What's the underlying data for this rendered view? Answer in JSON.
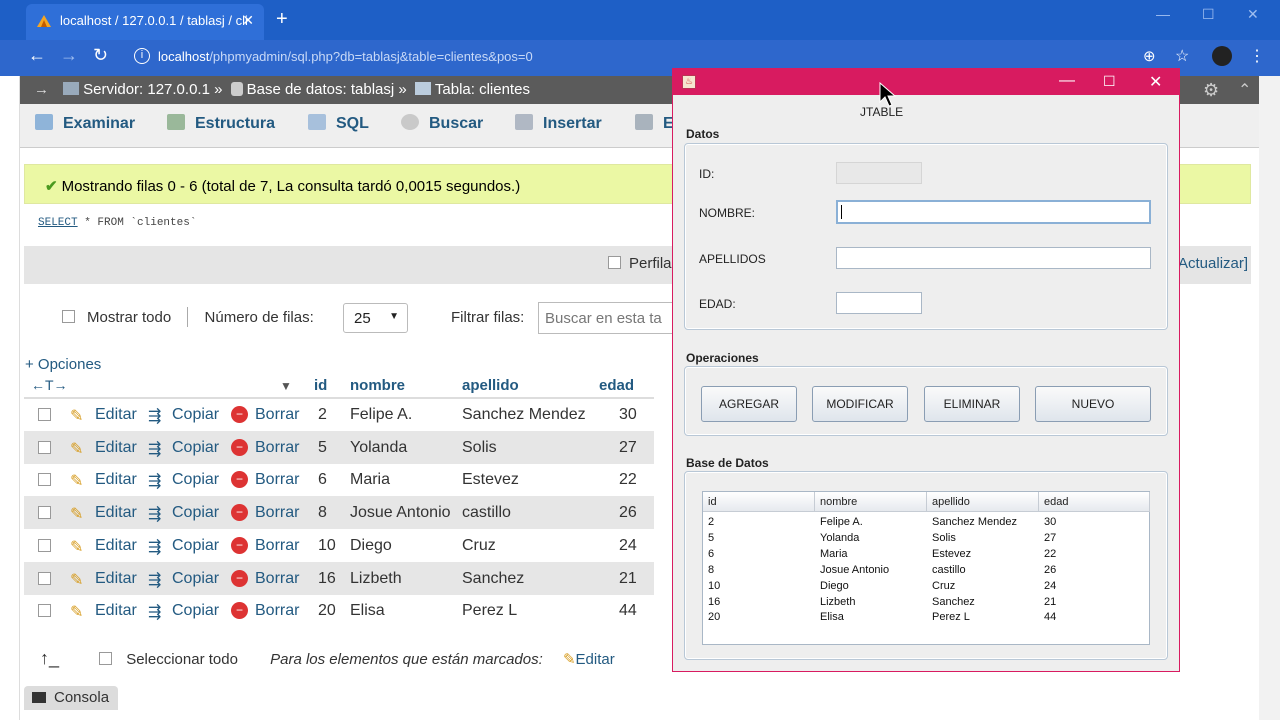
{
  "browser": {
    "tab_title": "localhost / 127.0.0.1 / tablasj / cli",
    "url_host": "localhost",
    "url_path": "/phpmyadmin/sql.php?db=tablasj&table=clientes&pos=0"
  },
  "pma": {
    "breadcrumb": {
      "server": "Servidor: 127.0.0.1 »",
      "db": "Base de datos: tablasj »",
      "table": "Tabla: clientes"
    },
    "tabs": [
      "Examinar",
      "Estructura",
      "SQL",
      "Buscar",
      "Insertar",
      "E"
    ],
    "success_msg": "Mostrando filas 0 - 6 (total de 7, La consulta tardó 0,0015 segundos.)",
    "sql_keyword": "SELECT",
    "sql_rest": " * FROM `clientes`",
    "perfil": "Perfila",
    "actualizar": "Actualizar]",
    "mostrar_todo": "Mostrar todo",
    "num_filas_label": "Número de filas:",
    "num_filas_value": "25",
    "filtrar_label": "Filtrar filas:",
    "buscar_placeholder": "Buscar en esta ta",
    "opciones": "+ Opciones",
    "columns": [
      "id",
      "nombre",
      "apellido",
      "edad"
    ],
    "actions": {
      "edit": "Editar",
      "copy": "Copiar",
      "delete": "Borrar"
    },
    "rows": [
      [
        "2",
        "Felipe A.",
        "Sanchez Mendez",
        "30"
      ],
      [
        "5",
        "Yolanda",
        "Solis",
        "27"
      ],
      [
        "6",
        "Maria",
        "Estevez",
        "22"
      ],
      [
        "8",
        "Josue Antonio",
        "castillo",
        "26"
      ],
      [
        "10",
        "Diego",
        "Cruz",
        "24"
      ],
      [
        "16",
        "Lizbeth",
        "Sanchez",
        "21"
      ],
      [
        "20",
        "Elisa",
        "Perez L",
        "44"
      ]
    ],
    "select_all": "Seleccionar todo",
    "for_marked": "Para los elementos que están marcados:",
    "bottom_edit": "Editar",
    "console": "Consola"
  },
  "jframe": {
    "heading": "JTABLE",
    "datos": "Datos",
    "id_label": "ID:",
    "nombre_label": "NOMBRE:",
    "apellidos_label": "APELLIDOS",
    "edad_label": "EDAD:",
    "operaciones": "Operaciones",
    "buttons": [
      "AGREGAR",
      "MODIFICAR",
      "ELIMINAR",
      "NUEVO"
    ],
    "base_datos": "Base de Datos",
    "columns": [
      "id",
      "nombre",
      "apellido",
      "edad"
    ],
    "rows": [
      [
        "2",
        "Felipe A.",
        "Sanchez Mendez",
        "30"
      ],
      [
        "5",
        "Yolanda",
        "Solis",
        "27"
      ],
      [
        "6",
        "Maria",
        "Estevez",
        "22"
      ],
      [
        "8",
        "Josue Antonio",
        "castillo",
        "26"
      ],
      [
        "10",
        "Diego",
        "Cruz",
        "24"
      ],
      [
        "16",
        "Lizbeth",
        "Sanchez",
        "21"
      ],
      [
        "20",
        "Elisa",
        "Perez L",
        "44"
      ]
    ]
  }
}
